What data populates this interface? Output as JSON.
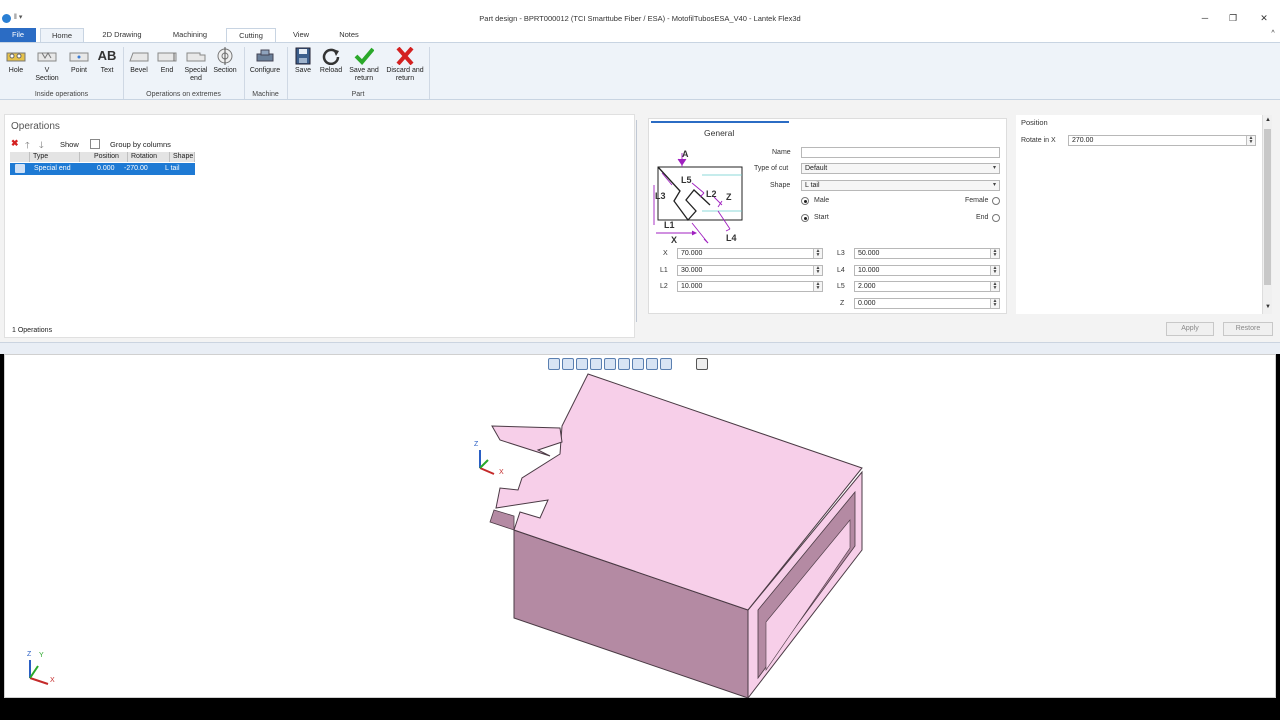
{
  "window": {
    "title": "Part design - BPRT000012 (TCI Smarttube Fiber / ESA) - MotofilTubosESA_V40 - Lantek Flex3d",
    "qat": "‖ ▾",
    "minimize": "─",
    "restore": "❐",
    "close": "✕"
  },
  "tabs": [
    {
      "label": "File"
    },
    {
      "label": "Home"
    },
    {
      "label": "2D Drawing"
    },
    {
      "label": "Machining"
    },
    {
      "label": "Cutting"
    },
    {
      "label": "View"
    },
    {
      "label": "Notes"
    }
  ],
  "ribbon": {
    "buttons": {
      "hole": "Hole",
      "vsection1": "V",
      "vsection2": "Section",
      "point": "Point",
      "text_icon": "AB",
      "text": "Text",
      "bevel": "Bevel",
      "end": "End",
      "special1": "Special",
      "special2": "end",
      "section": "Section",
      "configure": "Configure",
      "save": "Save",
      "reload": "Reload",
      "save_return1": "Save and",
      "save_return2": "return",
      "discard1": "Discard and",
      "discard2": "return"
    },
    "groups": {
      "inside": "Inside operations",
      "extremes": "Operations on extremes",
      "machine": "Machine",
      "part": "Part"
    }
  },
  "operations": {
    "header": "Operations",
    "show": "Show",
    "group_by": "Group by columns",
    "columns": [
      "Type",
      "Position",
      "Rotation",
      "Shape"
    ],
    "row": {
      "type": "Special end",
      "position": "0.000",
      "rotation": "-270.00",
      "shape": "L tail"
    },
    "count": "1 Operations"
  },
  "general": {
    "title": "General",
    "name_label": "Name",
    "name_value": "",
    "cut_label": "Type of cut",
    "cut_value": "Default",
    "shape_label": "Shape",
    "shape_value": "L tail",
    "male": "Male",
    "female": "Female",
    "start": "Start",
    "end": "End",
    "diagram_labels": {
      "a": "A",
      "l5": "L5",
      "l3": "L3",
      "l2": "L2",
      "z": "Z",
      "l1": "L1",
      "l4": "L4",
      "x": "X"
    },
    "params": [
      {
        "label": "X",
        "value": "70.000"
      },
      {
        "label": "L1",
        "value": "30.000"
      },
      {
        "label": "L2",
        "value": "10.000"
      },
      {
        "label": "L3",
        "value": "50.000"
      },
      {
        "label": "L4",
        "value": "10.000"
      },
      {
        "label": "L5",
        "value": "2.000"
      },
      {
        "label": "Z",
        "value": "0.000"
      }
    ]
  },
  "position": {
    "header": "Position",
    "rotate_label": "Rotate in X",
    "rotate_value": "270.00"
  },
  "actions": {
    "apply": "Apply",
    "restore": "Restore"
  },
  "axes": {
    "z": "Z",
    "y": "Y",
    "x": "X"
  },
  "colors": {
    "accent": "#2b6cc4",
    "part_face": "#f7cfe9",
    "part_side": "#b48aa3",
    "arrows": "#a020c0"
  }
}
